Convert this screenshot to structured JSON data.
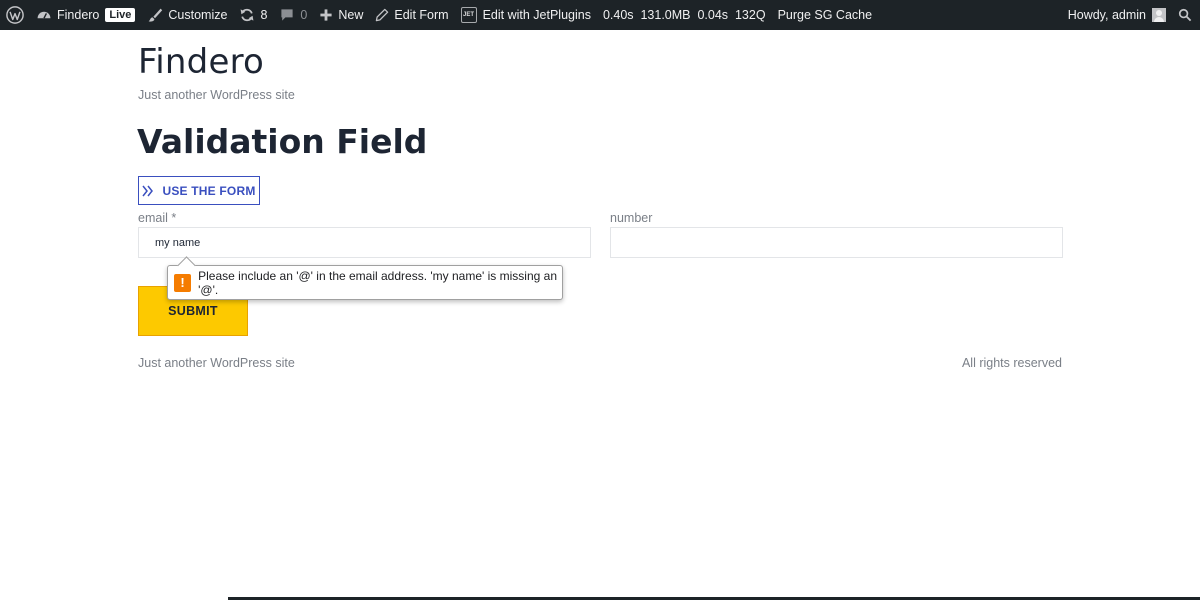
{
  "adminbar": {
    "site_name": "Findero",
    "live_badge": "Live",
    "customize": "Customize",
    "updates_count": "8",
    "comments_count": "0",
    "new": "New",
    "edit_form": "Edit Form",
    "jet_box": "JET",
    "edit_jetplugins": "Edit with JetPlugins",
    "stats": "0.40s  131.0MB  0.04s  132Q",
    "purge": "Purge SG Cache",
    "howdy": "Howdy, admin",
    "icons": [
      "wordpress-icon",
      "dashboard-icon",
      "brush-icon",
      "refresh-icon",
      "comment-icon",
      "plus-icon",
      "pencil-icon",
      "jet-icon",
      "avatar",
      "search-icon"
    ]
  },
  "site": {
    "title": "Findero",
    "tagline": "Just another WordPress site"
  },
  "page": {
    "title": "Validation Field",
    "use_form_button": "USE THE FORM"
  },
  "form": {
    "email_label": "email *",
    "email_value": "my name",
    "number_label": "number",
    "number_value": "",
    "submit_label": "SUBMIT",
    "validation_message": "Please include an '@' in the email address. 'my name' is missing an '@'."
  },
  "footer": {
    "left": "Just another WordPress site",
    "right": "All rights reserved"
  },
  "colors": {
    "adminbar_bg": "#1d2327",
    "accent_blue": "#3a4fbf",
    "submit_yellow": "#fdc900",
    "warning_orange": "#f57c00"
  }
}
